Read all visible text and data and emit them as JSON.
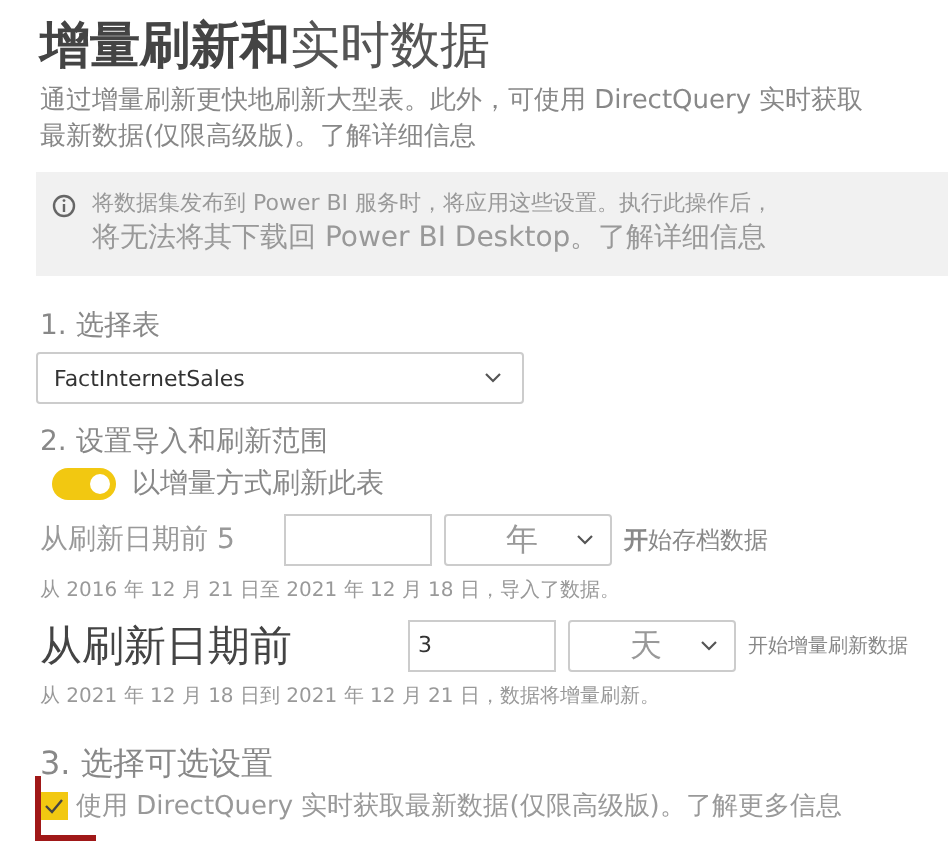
{
  "title": {
    "bold": "增量刷新和",
    "light": "实时数据"
  },
  "description": "通过增量刷新更快地刷新大型表。此外，可使用 DirectQuery 实时获取最新数据(仅限高级版)。了解详细信息",
  "info_banner": {
    "line1": "将数据集发布到 Power BI 服务时，将应用这些设置。执行此操作后，",
    "line2": "将无法将其下载回 Power BI Desktop。了解详细信息"
  },
  "steps": [
    {
      "heading": "1. 选择表",
      "select": {
        "value": "FactInternetSales"
      }
    },
    {
      "heading": "2. 设置导入和刷新范围",
      "toggle": {
        "label": "以增量方式刷新此表",
        "on": true
      },
      "ranges": [
        {
          "kind": "archive",
          "label": "从刷新日期前 5",
          "unit": "年",
          "suffix": "**开**始存档数据",
          "note": "从 2016 年 12 月 21 日至 2021 年 12 月 18 日，导入了数据。"
        },
        {
          "kind": "incremental",
          "label": "从刷新日期前",
          "value": "3",
          "unit": "天",
          "suffix": "开始增量刷新数据",
          "note": "从 2021 年 12 月 18 日到 2021 年 12 月 21 日，数据将增量刷新。"
        }
      ]
    },
    {
      "heading": "3. 选择可选设置",
      "checkbox": {
        "label": "使用 DirectQuery 实时获取最新数据(仅限高级版)。了解更多信息",
        "checked": true
      }
    }
  ]
}
